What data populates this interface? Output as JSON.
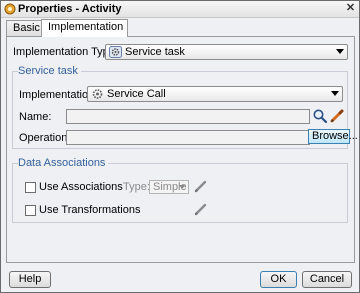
{
  "window": {
    "title": "Properties - Activity",
    "close_symbol": "✕"
  },
  "tabs": [
    {
      "label": "Basic",
      "selected": false
    },
    {
      "label": "Implementation",
      "selected": true
    }
  ],
  "implementation_type": {
    "label": "Implementation Type:",
    "value": "Service task",
    "icon": "service-task-gear-icon"
  },
  "service_task": {
    "group_title": "Service task",
    "implementation": {
      "label": "Implementation:",
      "value": "Service Call",
      "icon": "service-call-gear-icon"
    },
    "name": {
      "label": "Name:",
      "value": ""
    },
    "operation": {
      "label": "Operation:",
      "value": "",
      "browse_label": "Browse..."
    }
  },
  "data_associations": {
    "group_title": "Data Associations",
    "use_associations": {
      "label": "Use Associations",
      "checked": false
    },
    "type": {
      "label": "Type:",
      "value": "Simple"
    },
    "use_transformations": {
      "label": "Use Transformations",
      "checked": false
    }
  },
  "buttons": {
    "help": "Help",
    "ok": "OK",
    "cancel": "Cancel"
  },
  "colors": {
    "group_title": "#35609d",
    "window_background": "#eef0f3",
    "pencil": "#d46a1e"
  }
}
